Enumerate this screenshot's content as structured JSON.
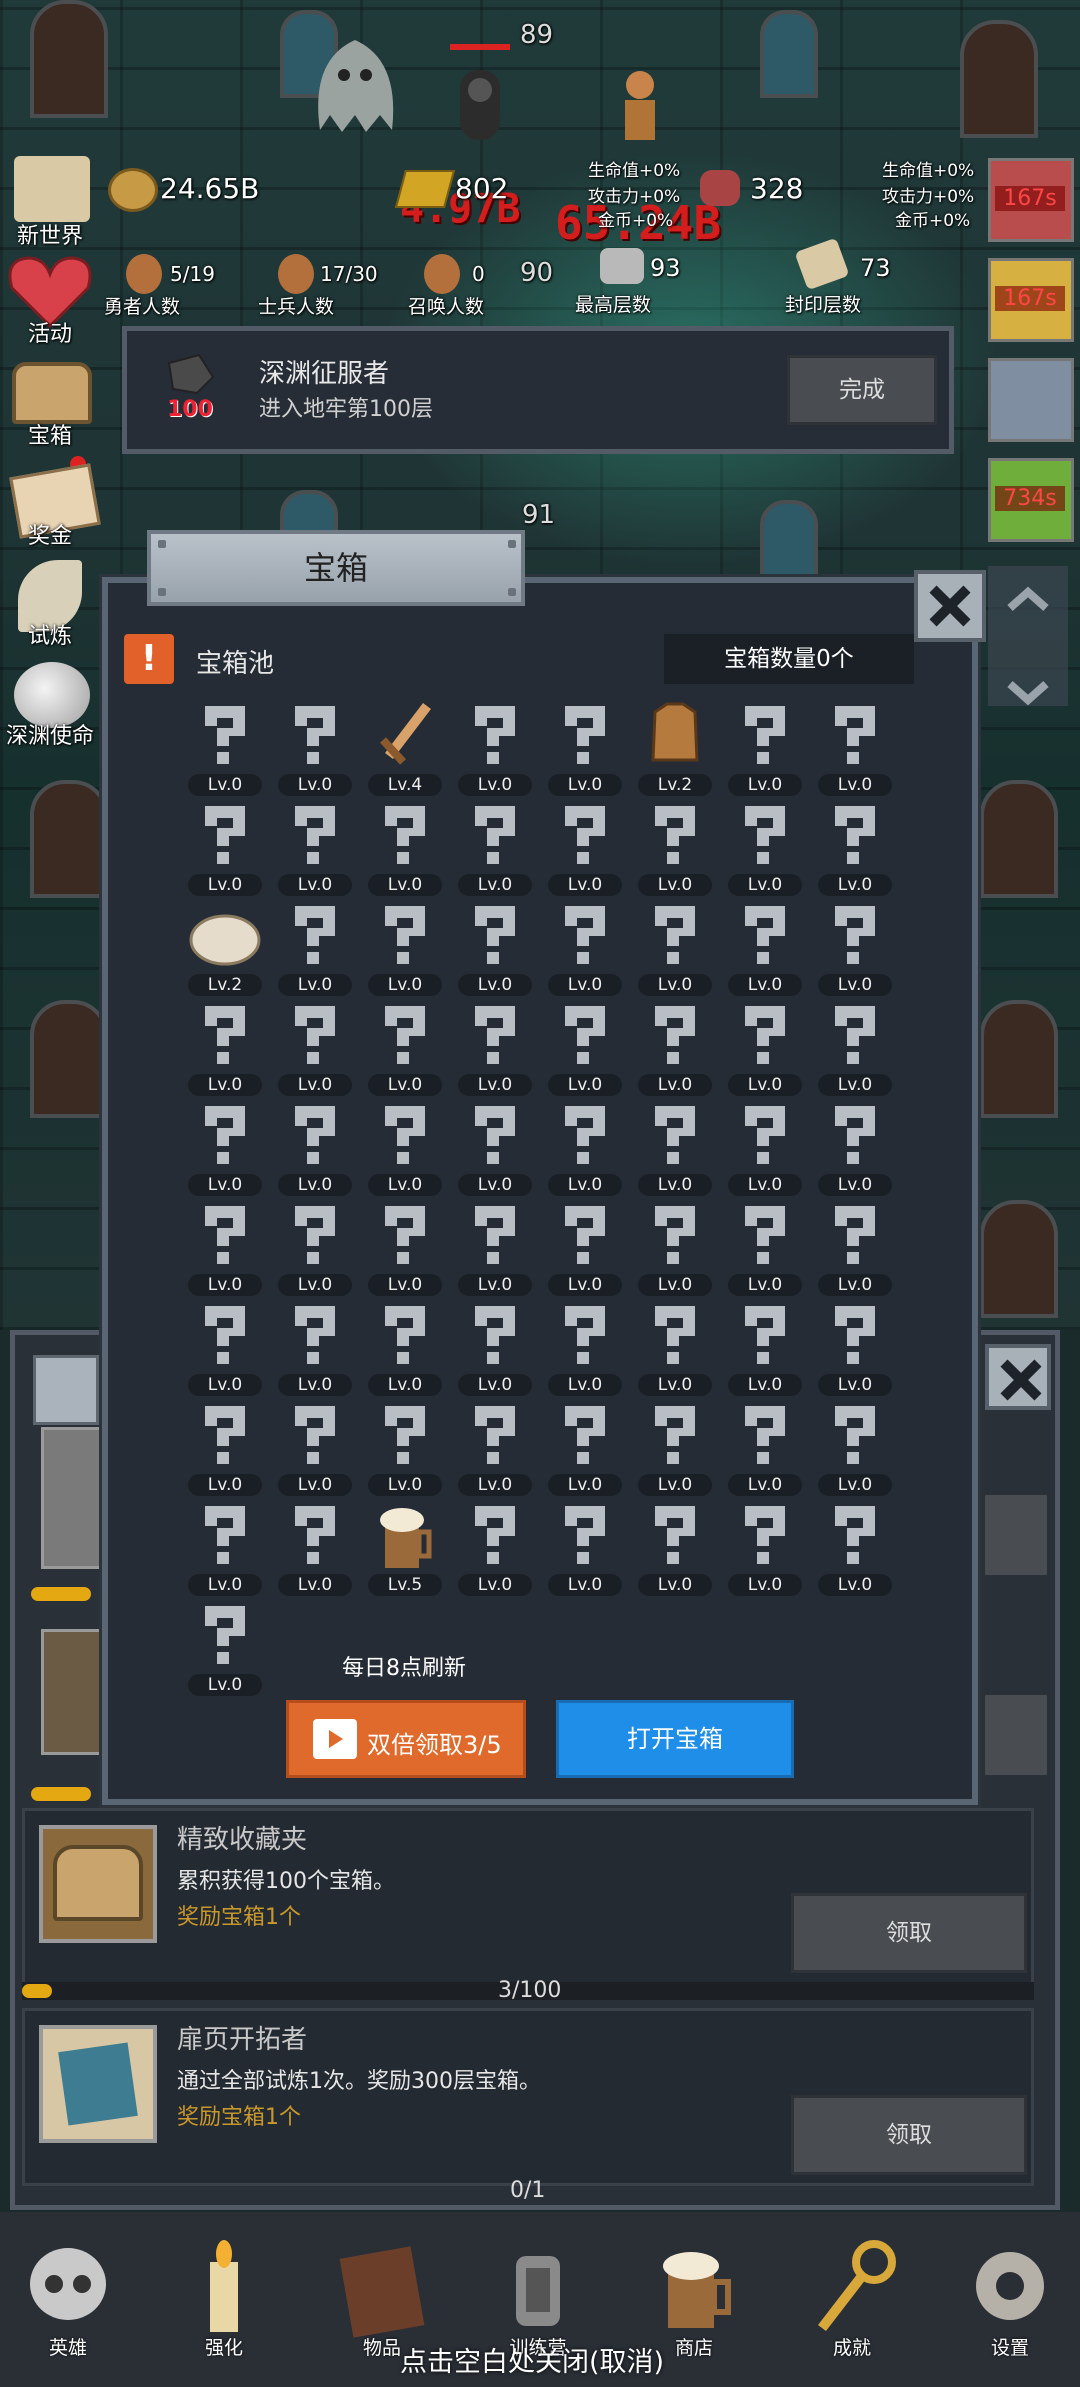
{
  "top_level": "89",
  "floor_91": "91",
  "floor_90": "90",
  "damage_1": "4.97B",
  "damage_2": "65.24B",
  "stats": {
    "gold": "24.65B",
    "bars": "802",
    "meat": "328",
    "buffs_left": [
      "生命值+0%",
      "攻击力+0%",
      "金币+0%"
    ],
    "buffs_right": [
      "生命值+0%",
      "攻击力+0%",
      "金币+0%"
    ],
    "heroes": {
      "value": "5/19",
      "label": "勇者人数"
    },
    "soldiers": {
      "value": "17/30",
      "label": "士兵人数"
    },
    "summons": {
      "value": "0",
      "label": "召唤人数"
    },
    "max_floor": {
      "value": "93",
      "label": "最高层数"
    },
    "sealed_floor": {
      "value": "73",
      "label": "封印层数"
    }
  },
  "sidebar": [
    "新世界",
    "活动",
    "宝箱",
    "奖金",
    "试炼",
    "深渊使命"
  ],
  "right_timers": [
    "167s",
    "167s",
    "734s"
  ],
  "quest": {
    "title": "深渊征服者",
    "desc": "进入地牢第100层",
    "badge": "100",
    "button": "完成"
  },
  "dialog": {
    "title": "宝箱",
    "pool_label": "宝箱池",
    "count_label": "宝箱数量0个",
    "refresh_note": "每日8点刷新",
    "double_button": "双倍领取3/5",
    "open_button": "打开宝箱",
    "items": [
      {
        "icon": "question",
        "lv": "Lv.0"
      },
      {
        "icon": "question",
        "lv": "Lv.0"
      },
      {
        "icon": "sword",
        "lv": "Lv.4"
      },
      {
        "icon": "question",
        "lv": "Lv.0"
      },
      {
        "icon": "question",
        "lv": "Lv.0"
      },
      {
        "icon": "armor",
        "lv": "Lv.2"
      },
      {
        "icon": "question",
        "lv": "Lv.0"
      },
      {
        "icon": "question",
        "lv": "Lv.0"
      },
      {
        "icon": "question",
        "lv": "Lv.0"
      },
      {
        "icon": "question",
        "lv": "Lv.0"
      },
      {
        "icon": "question",
        "lv": "Lv.0"
      },
      {
        "icon": "question",
        "lv": "Lv.0"
      },
      {
        "icon": "question",
        "lv": "Lv.0"
      },
      {
        "icon": "question",
        "lv": "Lv.0"
      },
      {
        "icon": "question",
        "lv": "Lv.0"
      },
      {
        "icon": "question",
        "lv": "Lv.0"
      },
      {
        "icon": "bun",
        "lv": "Lv.2"
      },
      {
        "icon": "question",
        "lv": "Lv.0"
      },
      {
        "icon": "question",
        "lv": "Lv.0"
      },
      {
        "icon": "question",
        "lv": "Lv.0"
      },
      {
        "icon": "question",
        "lv": "Lv.0"
      },
      {
        "icon": "question",
        "lv": "Lv.0"
      },
      {
        "icon": "question",
        "lv": "Lv.0"
      },
      {
        "icon": "question",
        "lv": "Lv.0"
      },
      {
        "icon": "question",
        "lv": "Lv.0"
      },
      {
        "icon": "question",
        "lv": "Lv.0"
      },
      {
        "icon": "question",
        "lv": "Lv.0"
      },
      {
        "icon": "question",
        "lv": "Lv.0"
      },
      {
        "icon": "question",
        "lv": "Lv.0"
      },
      {
        "icon": "question",
        "lv": "Lv.0"
      },
      {
        "icon": "question",
        "lv": "Lv.0"
      },
      {
        "icon": "question",
        "lv": "Lv.0"
      },
      {
        "icon": "question",
        "lv": "Lv.0"
      },
      {
        "icon": "question",
        "lv": "Lv.0"
      },
      {
        "icon": "question",
        "lv": "Lv.0"
      },
      {
        "icon": "question",
        "lv": "Lv.0"
      },
      {
        "icon": "question",
        "lv": "Lv.0"
      },
      {
        "icon": "question",
        "lv": "Lv.0"
      },
      {
        "icon": "question",
        "lv": "Lv.0"
      },
      {
        "icon": "question",
        "lv": "Lv.0"
      },
      {
        "icon": "question",
        "lv": "Lv.0"
      },
      {
        "icon": "question",
        "lv": "Lv.0"
      },
      {
        "icon": "question",
        "lv": "Lv.0"
      },
      {
        "icon": "question",
        "lv": "Lv.0"
      },
      {
        "icon": "question",
        "lv": "Lv.0"
      },
      {
        "icon": "question",
        "lv": "Lv.0"
      },
      {
        "icon": "question",
        "lv": "Lv.0"
      },
      {
        "icon": "question",
        "lv": "Lv.0"
      },
      {
        "icon": "question",
        "lv": "Lv.0"
      },
      {
        "icon": "question",
        "lv": "Lv.0"
      },
      {
        "icon": "question",
        "lv": "Lv.0"
      },
      {
        "icon": "question",
        "lv": "Lv.0"
      },
      {
        "icon": "question",
        "lv": "Lv.0"
      },
      {
        "icon": "question",
        "lv": "Lv.0"
      },
      {
        "icon": "question",
        "lv": "Lv.0"
      },
      {
        "icon": "question",
        "lv": "Lv.0"
      },
      {
        "icon": "question",
        "lv": "Lv.0"
      },
      {
        "icon": "question",
        "lv": "Lv.0"
      },
      {
        "icon": "question",
        "lv": "Lv.0"
      },
      {
        "icon": "question",
        "lv": "Lv.0"
      },
      {
        "icon": "question",
        "lv": "Lv.0"
      },
      {
        "icon": "question",
        "lv": "Lv.0"
      },
      {
        "icon": "question",
        "lv": "Lv.0"
      },
      {
        "icon": "question",
        "lv": "Lv.0"
      },
      {
        "icon": "question",
        "lv": "Lv.0"
      },
      {
        "icon": "question",
        "lv": "Lv.0"
      },
      {
        "icon": "beer",
        "lv": "Lv.5"
      },
      {
        "icon": "question",
        "lv": "Lv.0"
      },
      {
        "icon": "question",
        "lv": "Lv.0"
      },
      {
        "icon": "question",
        "lv": "Lv.0"
      },
      {
        "icon": "question",
        "lv": "Lv.0"
      },
      {
        "icon": "question",
        "lv": "Lv.0"
      },
      {
        "icon": "question",
        "lv": "Lv.0"
      }
    ]
  },
  "achievements": [
    {
      "title": "精致收藏夹",
      "desc": "累积获得100个宝箱。",
      "reward": "奖励宝箱1个",
      "button": "领取",
      "progress_text": "3/100",
      "progress": 0.03
    },
    {
      "title": "扉页开拓者",
      "desc": "通过全部试炼1次。奖励300层宝箱。",
      "reward": "奖励宝箱1个",
      "button": "领取",
      "progress_text": "0/1",
      "progress": 0
    }
  ],
  "nav": [
    "英雄",
    "强化",
    "物品",
    "训练营",
    "商店",
    "成就",
    "设置"
  ],
  "close_hint": "点击空白处关闭(取消)"
}
